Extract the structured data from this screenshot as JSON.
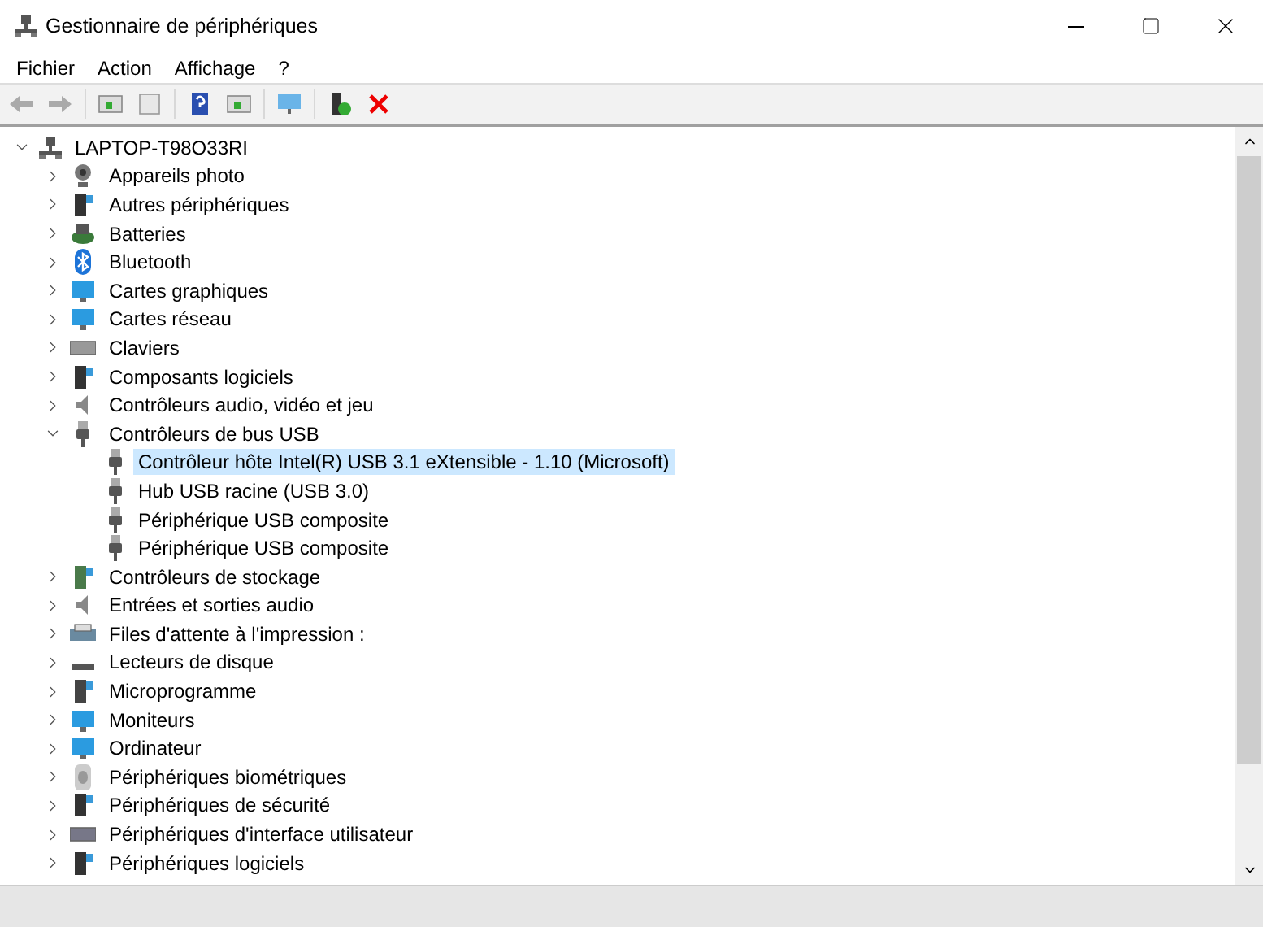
{
  "window": {
    "title": "Gestionnaire de périphériques"
  },
  "menu": [
    "Fichier",
    "Action",
    "Affichage",
    "?"
  ],
  "tree": {
    "label": "LAPTOP-T98O33RI",
    "expanded": true,
    "selected": false,
    "children": [
      {
        "label": "Appareils photo",
        "expanded": false,
        "selected": false
      },
      {
        "label": "Autres périphériques",
        "expanded": false,
        "selected": false
      },
      {
        "label": "Batteries",
        "expanded": false,
        "selected": false
      },
      {
        "label": "Bluetooth",
        "expanded": false,
        "selected": false
      },
      {
        "label": "Cartes graphiques",
        "expanded": false,
        "selected": false
      },
      {
        "label": "Cartes réseau",
        "expanded": false,
        "selected": false
      },
      {
        "label": "Claviers",
        "expanded": false,
        "selected": false
      },
      {
        "label": "Composants logiciels",
        "expanded": false,
        "selected": false
      },
      {
        "label": "Contrôleurs audio, vidéo et jeu",
        "expanded": false,
        "selected": false
      },
      {
        "label": "Contrôleurs de bus USB",
        "expanded": true,
        "selected": false,
        "children": [
          {
            "label": "Contrôleur hôte Intel(R) USB 3.1 eXtensible - 1.10 (Microsoft)",
            "selected": true
          },
          {
            "label": "Hub USB racine (USB 3.0)",
            "selected": false
          },
          {
            "label": "Périphérique USB composite",
            "selected": false
          },
          {
            "label": "Périphérique USB composite",
            "selected": false
          }
        ]
      },
      {
        "label": "Contrôleurs de stockage",
        "expanded": false,
        "selected": false
      },
      {
        "label": "Entrées et sorties audio",
        "expanded": false,
        "selected": false
      },
      {
        "label": "Files d'attente à l'impression :",
        "expanded": false,
        "selected": false
      },
      {
        "label": "Lecteurs de disque",
        "expanded": false,
        "selected": false
      },
      {
        "label": "Microprogramme",
        "expanded": false,
        "selected": false
      },
      {
        "label": "Moniteurs",
        "expanded": false,
        "selected": false
      },
      {
        "label": "Ordinateur",
        "expanded": false,
        "selected": false
      },
      {
        "label": "Périphériques biométriques",
        "expanded": false,
        "selected": false
      },
      {
        "label": "Périphériques de sécurité",
        "expanded": false,
        "selected": false
      },
      {
        "label": "Périphériques d'interface utilisateur",
        "expanded": false,
        "selected": false
      },
      {
        "label": "Périphériques logiciels",
        "expanded": false,
        "selected": false
      }
    ]
  }
}
